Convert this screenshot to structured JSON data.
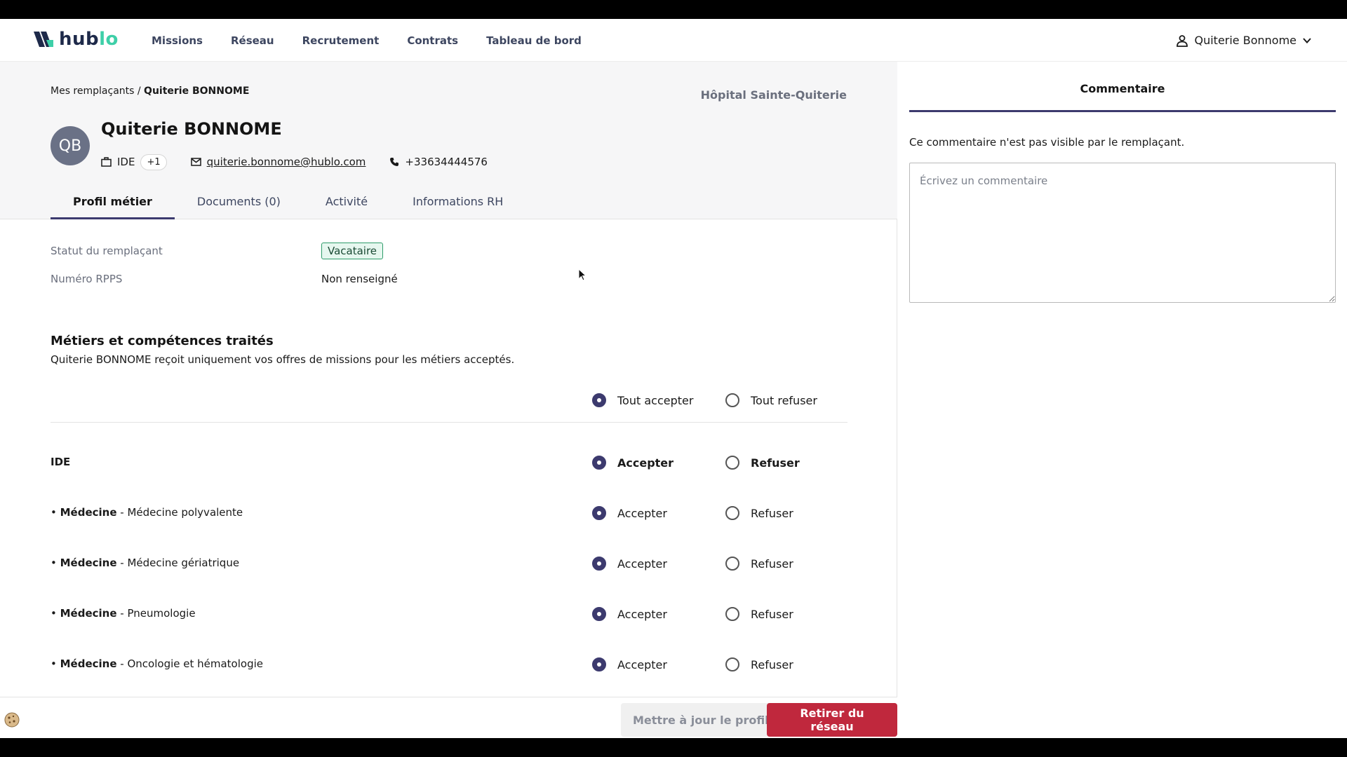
{
  "brand": {
    "name_part1": "hub",
    "name_part2": "lo"
  },
  "nav": {
    "items": [
      "Missions",
      "Réseau",
      "Recrutement",
      "Contrats",
      "Tableau de bord"
    ]
  },
  "user": {
    "name": "Quiterie Bonnome",
    "icon": "user-icon"
  },
  "breadcrumb": {
    "parent": "Mes remplaçants /",
    "current": "Quiterie BONNOME"
  },
  "hospital": "Hôpital Sainte-Quiterie",
  "profile": {
    "initials": "QB",
    "name": "Quiterie BONNOME",
    "job": "IDE",
    "job_extra": "+1",
    "email": "quiterie.bonnome@hublo.com",
    "phone": "+33634444576"
  },
  "tabs": [
    "Profil métier",
    "Documents (0)",
    "Activité",
    "Informations RH"
  ],
  "fields": {
    "status_label": "Statut du remplaçant",
    "status_value": "Vacataire",
    "rpps_label": "Numéro RPPS",
    "rpps_value": "Non renseigné"
  },
  "section": {
    "title": "Métiers et compétences traités",
    "desc": "Quiterie BONNOME reçoit uniquement vos offres de missions pour les métiers acceptés."
  },
  "global": {
    "accept_all": "Tout accepter",
    "refuse_all": "Tout refuser"
  },
  "jobs": [
    {
      "prefix": "",
      "name": "IDE",
      "detail": "",
      "accept": "Accepter",
      "refuse": "Refuser",
      "selected": "accept"
    },
    {
      "prefix": "• ",
      "name": "Médecine",
      "detail": " - Médecine polyvalente",
      "accept": "Accepter",
      "refuse": "Refuser",
      "selected": "accept"
    },
    {
      "prefix": "• ",
      "name": "Médecine",
      "detail": " - Médecine gériatrique",
      "accept": "Accepter",
      "refuse": "Refuser",
      "selected": "accept"
    },
    {
      "prefix": "• ",
      "name": "Médecine",
      "detail": " - Pneumologie",
      "accept": "Accepter",
      "refuse": "Refuser",
      "selected": "accept"
    },
    {
      "prefix": "• ",
      "name": "Médecine",
      "detail": " - Oncologie et hématologie",
      "accept": "Accepter",
      "refuse": "Refuser",
      "selected": "accept"
    }
  ],
  "footer": {
    "update": "Mettre à jour le profil",
    "remove": "Retirer du réseau"
  },
  "comment": {
    "tab": "Commentaire",
    "note": "Ce commentaire n'est pas visible par le remplaçant.",
    "placeholder": "Écrivez un commentaire"
  },
  "colors": {
    "accent": "#3c3a6e",
    "danger": "#c0283d",
    "brand_green": "#3ecfa8",
    "badge": "#2e9c6a"
  }
}
